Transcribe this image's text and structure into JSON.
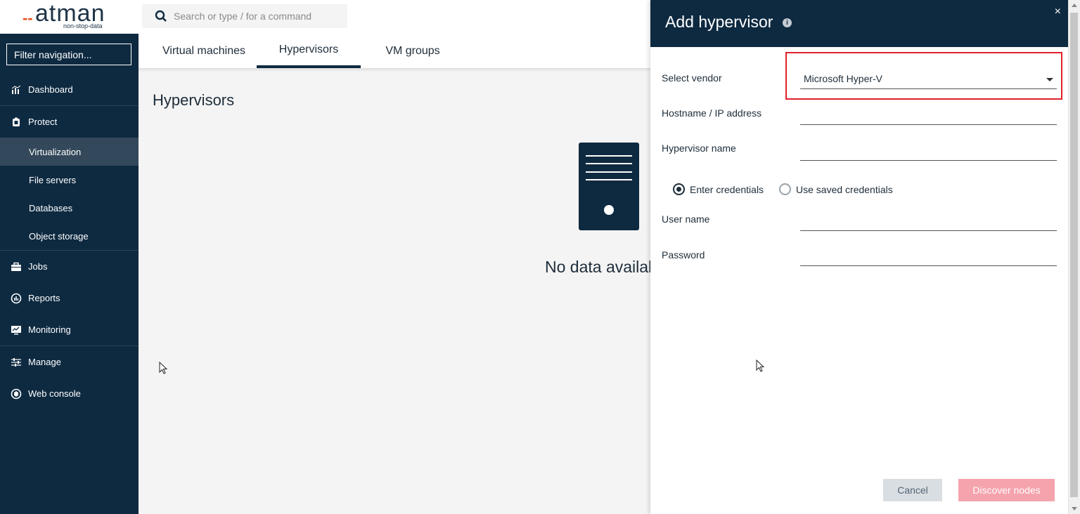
{
  "logo": {
    "text": "atman",
    "dash": "--",
    "tagline": "non-stop-data"
  },
  "sidebar": {
    "filter_placeholder": "Filter navigation...",
    "items": {
      "dashboard": {
        "label": "Dashboard",
        "icon": "chart-icon"
      },
      "protect": {
        "label": "Protect",
        "icon": "shield-icon"
      },
      "virtualization": {
        "label": "Virtualization"
      },
      "file_servers": {
        "label": "File servers"
      },
      "databases": {
        "label": "Databases"
      },
      "object_storage": {
        "label": "Object storage"
      },
      "jobs": {
        "label": "Jobs",
        "icon": "briefcase-icon"
      },
      "reports": {
        "label": "Reports",
        "icon": "reports-icon"
      },
      "monitoring": {
        "label": "Monitoring",
        "icon": "monitor-icon"
      },
      "manage": {
        "label": "Manage",
        "icon": "sliders-icon"
      },
      "web_console": {
        "label": "Web console",
        "icon": "console-icon"
      }
    }
  },
  "search": {
    "placeholder": "Search or type / for a command"
  },
  "tabs": {
    "virtual_machines": "Virtual machines",
    "hypervisors": "Hypervisors",
    "vm_groups": "VM groups",
    "active": "Hypervisors"
  },
  "main": {
    "title": "Hypervisors",
    "empty_text": "No data available"
  },
  "drawer": {
    "title": "Add hypervisor",
    "close": "×",
    "info_icon": "i",
    "vendor_label": "Select vendor",
    "vendor_value": "Microsoft Hyper-V",
    "hostname_label": "Hostname / IP address",
    "hypervisor_name_label": "Hypervisor name",
    "radio_enter": "Enter credentials",
    "radio_saved": "Use saved credentials",
    "username_label": "User name",
    "password_label": "Password",
    "cancel_label": "Cancel",
    "discover_label": "Discover nodes"
  },
  "colors": {
    "navy": "#0e2a41",
    "highlight_red": "#e0202a",
    "discover_pink": "#f5a3ad"
  }
}
